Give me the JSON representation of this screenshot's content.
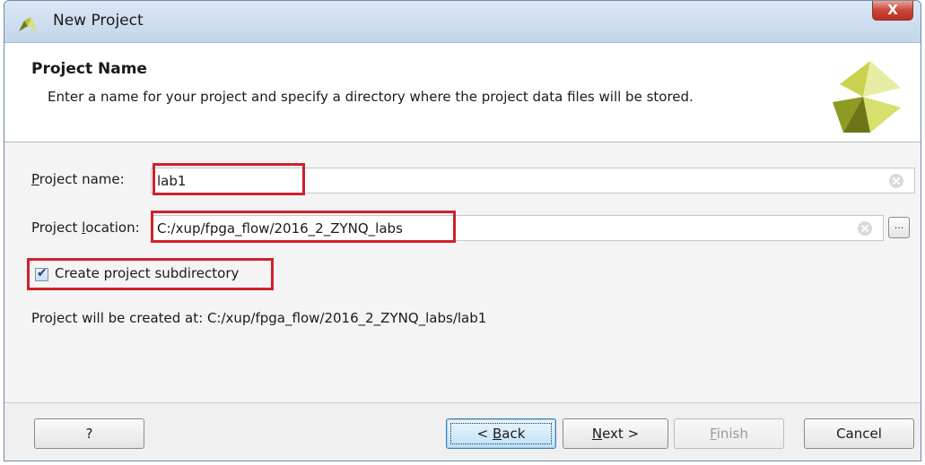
{
  "window": {
    "title": "New Project",
    "close_label": "X"
  },
  "header": {
    "title": "Project Name",
    "description": "Enter a name for your project and specify a directory where the project data files will be stored."
  },
  "form": {
    "project_name_label_mnemonic": "P",
    "project_name_label_rest": "roject name:",
    "project_name_value": "lab1",
    "project_location_label_pre": "Project ",
    "project_location_label_mnemonic": "l",
    "project_location_label_post": "ocation:",
    "project_location_value": "C:/xup/fpga_flow/2016_2_ZYNQ_labs",
    "browse_label": "...",
    "create_subdir_label": "Create project subdirectory",
    "create_subdir_checked": true,
    "result_text": "Project will be created at: C:/xup/fpga_flow/2016_2_ZYNQ_labs/lab1"
  },
  "buttons": {
    "help": "?",
    "back_pre": "< ",
    "back_mnemonic": "B",
    "back_post": "ack",
    "next_mnemonic": "N",
    "next_post": "ext >",
    "finish_mnemonic": "F",
    "finish_post": "inish",
    "cancel": "Cancel"
  },
  "colors": {
    "highlight": "#d0202c",
    "titlebar": "#c3d5ea",
    "close_button": "#c9473a"
  }
}
